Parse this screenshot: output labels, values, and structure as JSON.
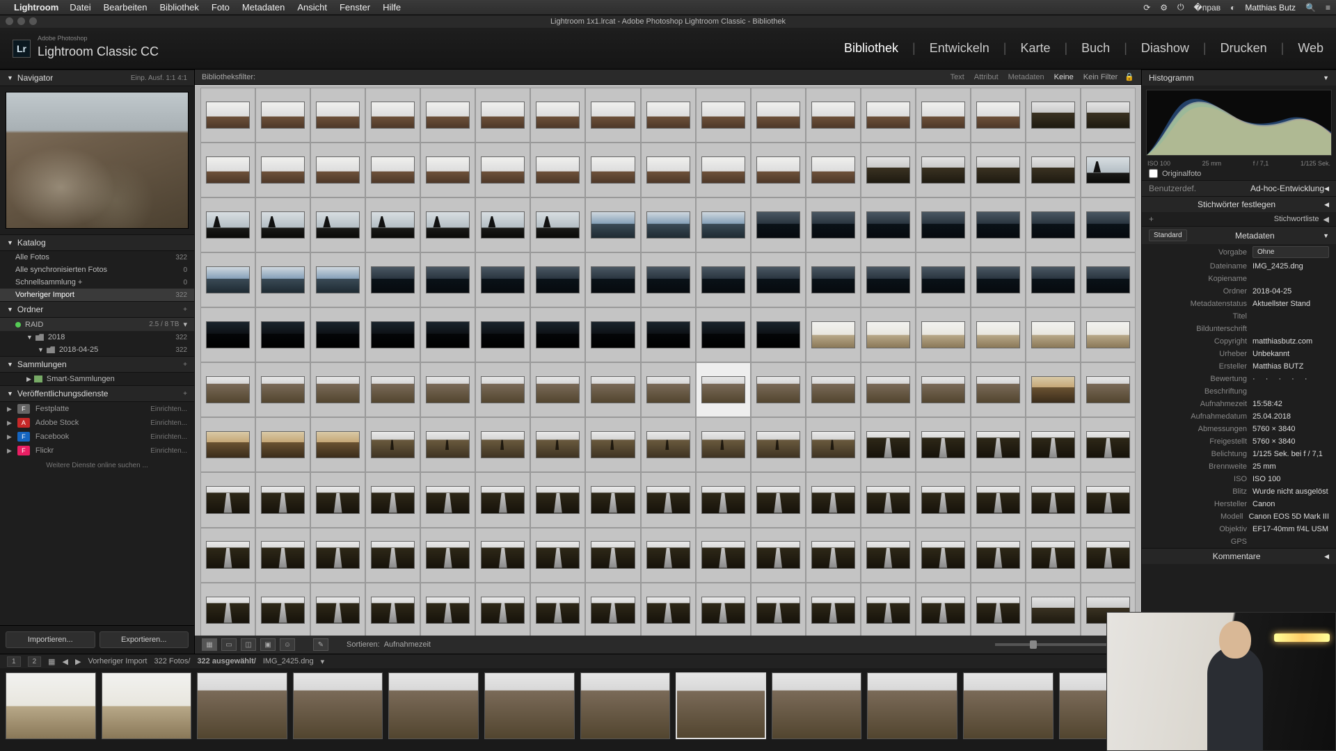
{
  "os_menu": {
    "app": "Lightroom",
    "items": [
      "Datei",
      "Bearbeiten",
      "Bibliothek",
      "Foto",
      "Metadaten",
      "Ansicht",
      "Fenster",
      "Hilfe"
    ],
    "user": "Matthias Butz"
  },
  "window_title": "Lightroom 1x1.lrcat - Adobe Photoshop Lightroom Classic - Bibliothek",
  "brand": {
    "sub": "Adobe Photoshop",
    "name": "Lightroom Classic CC",
    "badge": "Lr"
  },
  "modules": [
    "Bibliothek",
    "Entwickeln",
    "Karte",
    "Buch",
    "Diashow",
    "Drucken",
    "Web"
  ],
  "active_module": "Bibliothek",
  "navigator": {
    "title": "Navigator",
    "modes": "Einp.   Ausf.   1:1   4:1"
  },
  "catalog": {
    "title": "Katalog",
    "rows": [
      {
        "label": "Alle Fotos",
        "count": "322"
      },
      {
        "label": "Alle synchronisierten Fotos",
        "count": "0"
      },
      {
        "label": "Schnellsammlung  +",
        "count": "0"
      },
      {
        "label": "Vorheriger Import",
        "count": "322",
        "sel": true
      }
    ]
  },
  "folders": {
    "title": "Ordner",
    "drive": {
      "label": "RAID",
      "count": "2.5 / 8 TB"
    },
    "tree": [
      {
        "label": "2018",
        "count": "322",
        "indent": 1
      },
      {
        "label": "2018-04-25",
        "count": "322",
        "indent": 2
      }
    ]
  },
  "collections": {
    "title": "Sammlungen",
    "smart": "Smart-Sammlungen"
  },
  "publish": {
    "title": "Veröffentlichungsdienste",
    "services": [
      {
        "name": "Festplatte",
        "btn": "Einrichten...",
        "color": "#666"
      },
      {
        "name": "Adobe Stock",
        "btn": "Einrichten...",
        "color": "#c62828"
      },
      {
        "name": "Facebook",
        "btn": "Einrichten...",
        "color": "#1565c0"
      },
      {
        "name": "Flickr",
        "btn": "Einrichten...",
        "color": "#e91e63"
      }
    ],
    "footer": "Weitere Dienste online suchen ..."
  },
  "import_btn": "Importieren...",
  "export_btn": "Exportieren...",
  "filter_bar": {
    "label": "Bibliotheksfilter:",
    "tabs": [
      "Text",
      "Attribut",
      "Metadaten",
      "Keine"
    ],
    "active": "Keine",
    "right": "Kein Filter"
  },
  "sort": {
    "label": "Sortieren:",
    "value": "Aufnahmezeit"
  },
  "histogram": {
    "title": "Histogramm",
    "iso": "ISO 100",
    "focal": "25 mm",
    "aperture": "f / 7,1",
    "shutter": "1/125 Sek."
  },
  "orig": "Originalfoto",
  "quick": {
    "title": "Ad-hoc-Entwicklung"
  },
  "keywords": {
    "title": "Stichwörter festlegen",
    "list": "Stichwortliste"
  },
  "metadata": {
    "title": "Metadaten",
    "preset_lbl": "Vorgabe",
    "preset_val": "Ohne",
    "mode": "Standard",
    "rows": [
      {
        "lbl": "Dateiname",
        "val": "IMG_2425.dng"
      },
      {
        "lbl": "Kopiename",
        "val": ""
      },
      {
        "lbl": "Ordner",
        "val": "2018-04-25"
      },
      {
        "lbl": "Metadatenstatus",
        "val": "Aktuellster Stand"
      },
      {
        "lbl": "Titel",
        "val": ""
      },
      {
        "lbl": "Bildunterschrift",
        "val": ""
      },
      {
        "lbl": "Copyright",
        "val": "matthiasbutz.com"
      },
      {
        "lbl": "Urheber",
        "val": "Unbekannt"
      },
      {
        "lbl": "Ersteller",
        "val": "Matthias BUTZ"
      },
      {
        "lbl": "Bewertung",
        "val": "· · · · ·"
      },
      {
        "lbl": "Beschriftung",
        "val": ""
      },
      {
        "lbl": "Aufnahmezeit",
        "val": "15:58:42"
      },
      {
        "lbl": "Aufnahmedatum",
        "val": "25.04.2018"
      },
      {
        "lbl": "Abmessungen",
        "val": "5760 × 3840"
      },
      {
        "lbl": "Freigestellt",
        "val": "5760 × 3840"
      },
      {
        "lbl": "Belichtung",
        "val": "1/125 Sek. bei f / 7,1"
      },
      {
        "lbl": "Brennweite",
        "val": "25 mm"
      },
      {
        "lbl": "ISO",
        "val": "ISO 100"
      },
      {
        "lbl": "Blitz",
        "val": "Wurde nicht ausgelöst"
      },
      {
        "lbl": "Hersteller",
        "val": "Canon"
      },
      {
        "lbl": "Modell",
        "val": "Canon EOS 5D Mark III"
      },
      {
        "lbl": "Objektiv",
        "val": "EF17-40mm f/4L USM"
      },
      {
        "lbl": "GPS",
        "val": ""
      }
    ]
  },
  "comments": {
    "title": "Kommentare"
  },
  "filmstrip": {
    "nav_src": "Vorheriger Import",
    "count": "322 Fotos/",
    "sel": "322 ausgewählt/",
    "file": "IMG_2425.dng"
  },
  "grid_rows": [
    [
      "sky",
      "sky",
      "sky",
      "sky",
      "sky",
      "sky",
      "sky",
      "sky",
      "sky",
      "sky",
      "sky",
      "sky",
      "sky",
      "sky",
      "sky",
      "mtn",
      "mtn"
    ],
    [
      "sky",
      "sky",
      "sky",
      "sky",
      "sky",
      "sky",
      "sky",
      "sky",
      "sky",
      "sky",
      "sky",
      "sky",
      "mtn",
      "mtn",
      "mtn",
      "mtn",
      "silh"
    ],
    [
      "silh",
      "silh",
      "silh",
      "silh",
      "silh",
      "silh",
      "silh",
      "lake",
      "lake",
      "lake",
      "dark",
      "dark",
      "dark",
      "dark",
      "dark",
      "dark",
      "dark"
    ],
    [
      "lake",
      "lake",
      "lake",
      "dark",
      "dark",
      "dark",
      "dark",
      "dark",
      "dark",
      "dark",
      "dark",
      "dark",
      "dark",
      "dark",
      "dark",
      "dark",
      "dark"
    ],
    [
      "darker",
      "darker",
      "darker",
      "darker",
      "darker",
      "darker",
      "darker",
      "darker",
      "darker",
      "darker",
      "darker",
      "beach",
      "beach",
      "beach",
      "beach",
      "beach",
      "beach"
    ],
    [
      "rocks",
      "rocks",
      "rocks",
      "rocks",
      "rocks",
      "rocks",
      "rocks",
      "rocks",
      "rocks",
      "rocks",
      "rocks",
      "rocks",
      "rocks",
      "rocks",
      "rocks",
      "warm",
      "rocks"
    ],
    [
      "warm",
      "warm",
      "warm",
      "person",
      "person",
      "person",
      "person",
      "person",
      "person",
      "person",
      "person",
      "person",
      "gorge",
      "gorge",
      "gorge",
      "gorge",
      "gorge"
    ],
    [
      "gorge",
      "gorge",
      "gorge",
      "gorge",
      "gorge",
      "gorge",
      "gorge",
      "gorge",
      "gorge",
      "gorge",
      "gorge",
      "gorge",
      "gorge",
      "gorge",
      "gorge",
      "gorge",
      "gorge"
    ],
    [
      "gorge",
      "gorge",
      "gorge",
      "gorge",
      "gorge",
      "gorge",
      "gorge",
      "gorge",
      "gorge",
      "gorge",
      "gorge",
      "gorge",
      "gorge",
      "gorge",
      "gorge",
      "gorge",
      "gorge"
    ],
    [
      "gorge",
      "gorge",
      "gorge",
      "gorge",
      "gorge",
      "gorge",
      "gorge",
      "gorge",
      "gorge",
      "gorge",
      "gorge",
      "gorge",
      "gorge",
      "gorge",
      "gorge",
      "mtn",
      "mtn"
    ]
  ],
  "selected_cell": [
    5,
    9
  ]
}
